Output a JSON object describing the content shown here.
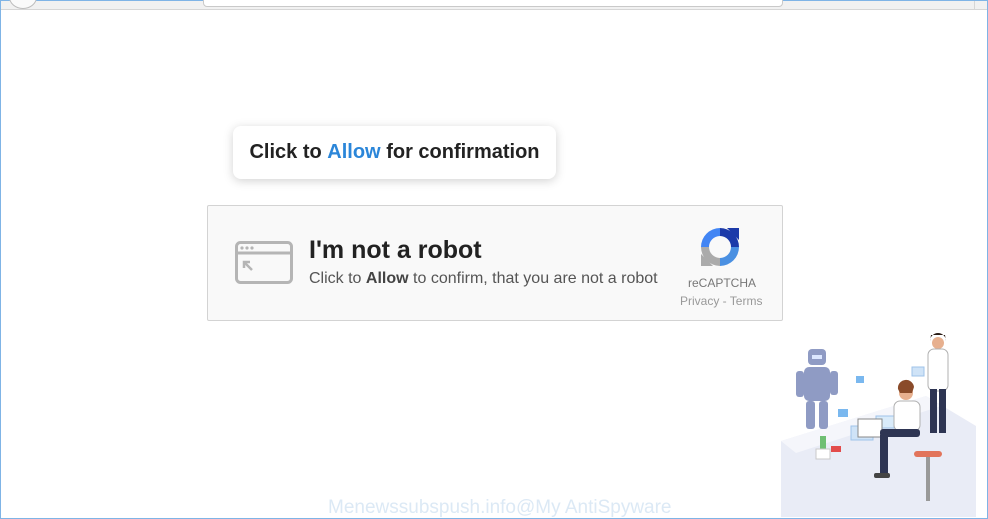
{
  "browser": {
    "url": ""
  },
  "tooltip": {
    "prefix": "Click to",
    "allow": "Allow",
    "suffix": "for confirmation"
  },
  "captcha": {
    "title": "I'm not a robot",
    "sub_prefix": "Click to",
    "sub_allow": "Allow",
    "sub_suffix": "to confirm, that you are not a robot",
    "brand": "reCAPTCHA",
    "links": "Privacy - Terms",
    "icons": {
      "browser": "browser-window-icon",
      "logo": "recaptcha-logo-icon"
    }
  },
  "watermark": "Menewssubspush.info@My AntiSpyware",
  "colors": {
    "allow_blue": "#2b86d9",
    "frame_border": "#7fb4e6"
  },
  "illustration": {
    "name": "robot-and-people-illustration"
  }
}
